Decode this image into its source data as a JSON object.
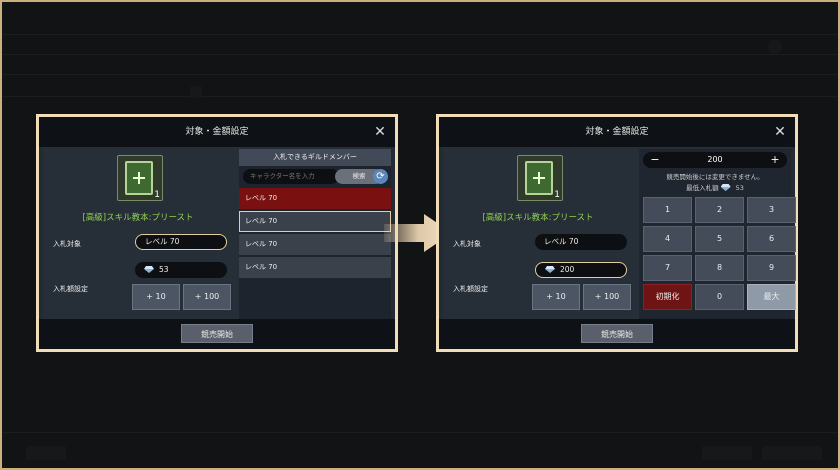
{
  "left_modal": {
    "title": "対象・金額設定",
    "item_count": "1",
    "item_name": "[高級]スキル教本:プリースト",
    "bid_target_label": "入札対象",
    "bid_target_value": "レベル 70",
    "bid_amount_label": "入札額設定",
    "current_amount": "53",
    "plus10": "+ 10",
    "plus100": "+ 100",
    "start_button": "競売開始",
    "members_header": "入札できるギルドメンバー",
    "search_placeholder": "キャラクター名を入力",
    "search_button": "検索",
    "members": [
      "レベル 70",
      "レベル 70",
      "レベル 70",
      "レベル 70"
    ]
  },
  "right_modal": {
    "title": "対象・金額設定",
    "item_count": "1",
    "item_name": "[高級]スキル教本:プリースト",
    "bid_target_label": "入札対象",
    "bid_target_value": "レベル 70",
    "bid_amount_label": "入札額設定",
    "current_amount": "200",
    "plus10": "+ 10",
    "plus100": "+ 100",
    "start_button": "競売開始",
    "quantity": "200",
    "note": "競売開始後には変更できません。",
    "min_bid_label": "最低入札額",
    "min_bid_value": "53",
    "keys": [
      "1",
      "2",
      "3",
      "4",
      "5",
      "6",
      "7",
      "8",
      "9",
      "初期化",
      "0",
      "最大"
    ]
  },
  "colors": {
    "frame": "#c9b07c",
    "highlight": "#f3dcb8",
    "item_name": "#8fd14f",
    "selected_row": "#7a1010"
  }
}
